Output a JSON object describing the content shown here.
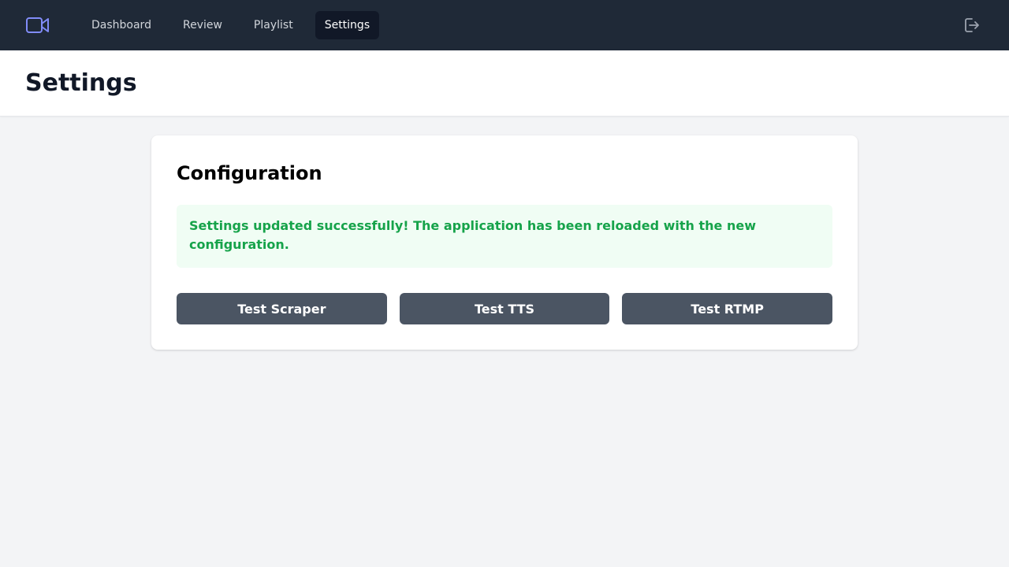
{
  "nav": {
    "logo_icon": "video-camera-icon",
    "items": [
      {
        "label": "Dashboard"
      },
      {
        "label": "Review"
      },
      {
        "label": "Playlist"
      },
      {
        "label": "Settings",
        "active": true
      }
    ],
    "logout_icon": "logout-icon"
  },
  "header": {
    "title": "Settings"
  },
  "config": {
    "title": "Configuration",
    "alert_text": "Settings updated successfully! The application has been reloaded with the new configuration.",
    "buttons": [
      {
        "label": "Test Scraper"
      },
      {
        "label": "Test TTS"
      },
      {
        "label": "Test RTMP"
      }
    ]
  },
  "colors": {
    "nav_bg": "#1f2937",
    "accent": "#818cf8",
    "success_text": "#16a34a",
    "success_bg": "#f0fdf4",
    "button_bg": "#4b5563"
  }
}
